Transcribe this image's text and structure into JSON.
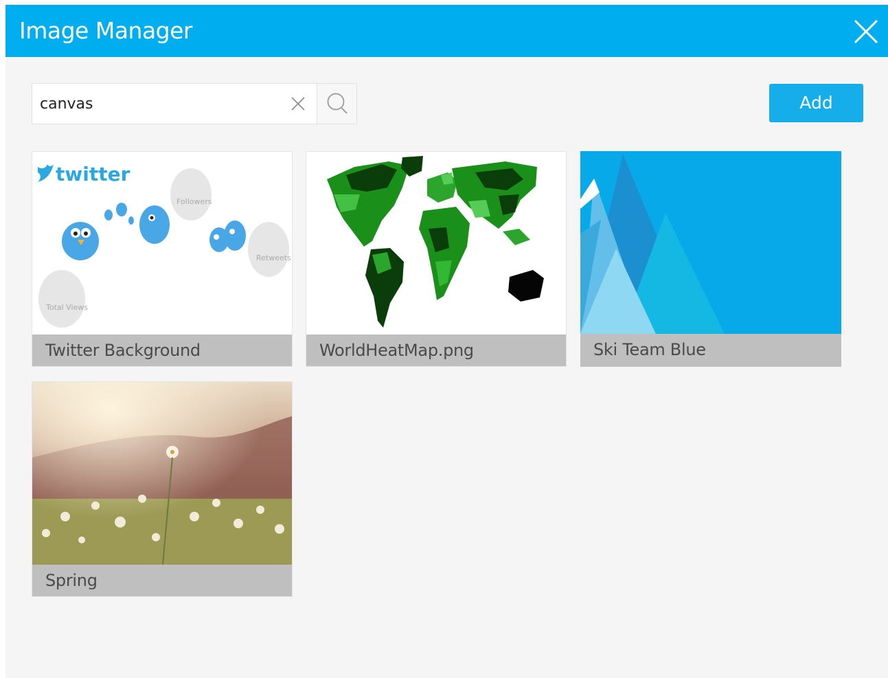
{
  "dialog": {
    "title": "Image Manager"
  },
  "search": {
    "value": "canvas",
    "placeholder": ""
  },
  "toolbar": {
    "add_label": "Add"
  },
  "images": [
    {
      "name": "Twitter Background",
      "thumb": {
        "logo": "twitter",
        "bubbles": [
          "Followers",
          "Retweets",
          "Total Views"
        ]
      }
    },
    {
      "name": "WorldHeatMap.png"
    },
    {
      "name": "Ski Team Blue"
    },
    {
      "name": "Spring"
    }
  ],
  "colors": {
    "accent": "#00aeef",
    "button": "#15aeea",
    "caption_bg": "#bfbfbf",
    "dialog_bg": "#f5f5f5"
  },
  "icons": {
    "close": "close-icon",
    "clear": "clear-icon",
    "search": "search-icon"
  }
}
